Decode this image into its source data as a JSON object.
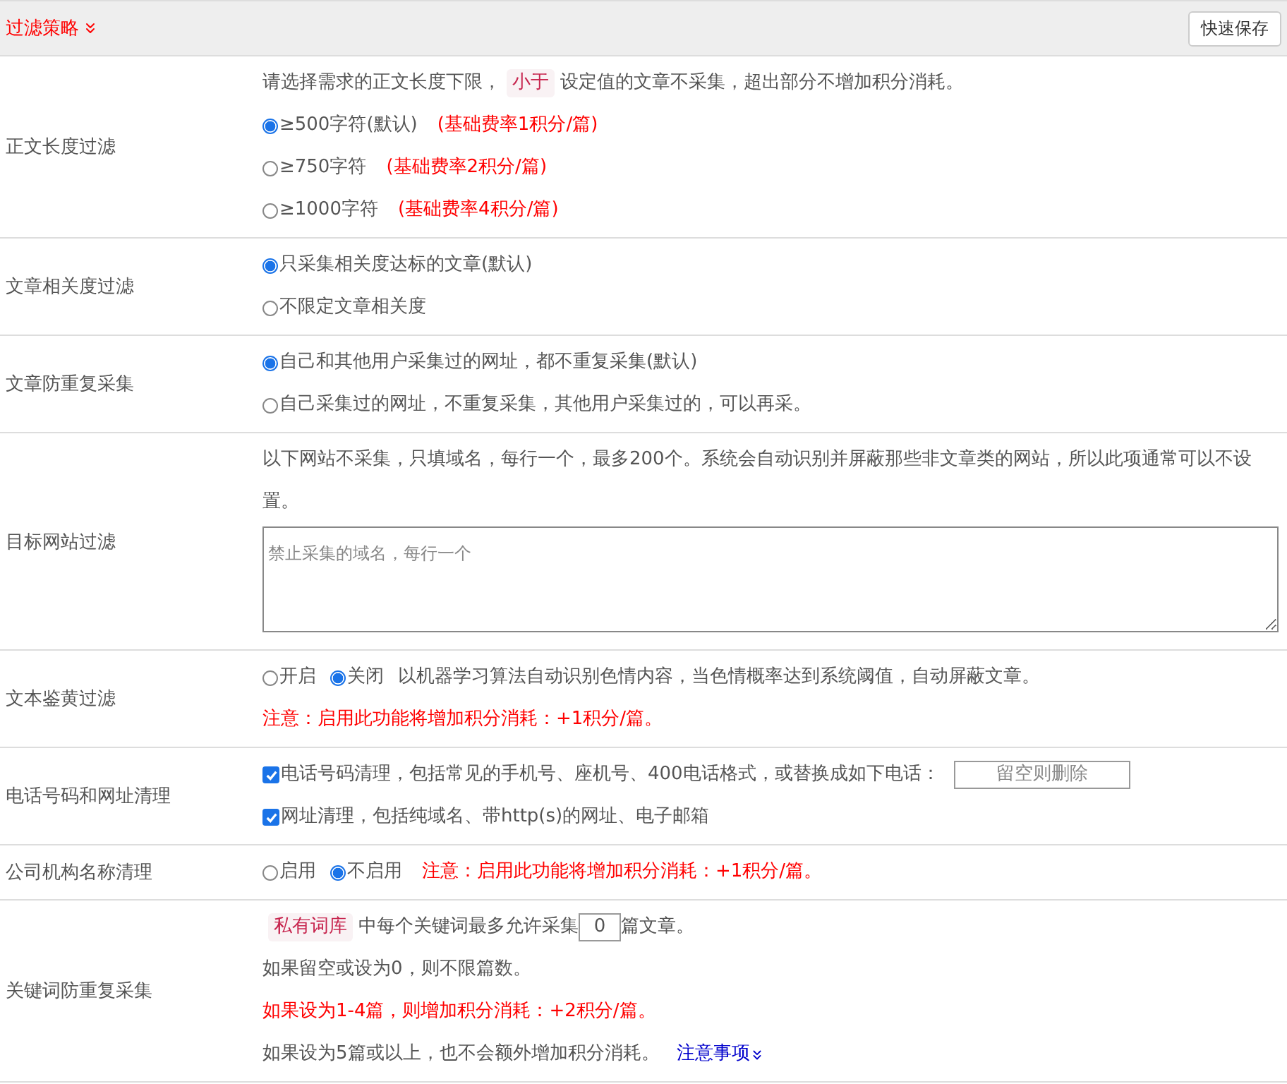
{
  "header": {
    "title": "过滤策略",
    "save_button": "快速保存"
  },
  "rows": [
    {
      "label": "正文长度过滤",
      "lines": [
        {
          "segments": [
            {
              "kind": "text",
              "text": "请选择需求的正文长度下限，"
            },
            {
              "kind": "badge",
              "text": "小于"
            },
            {
              "kind": "text",
              "text": "设定值的文章不采集，超出部分不增加积分消耗。"
            }
          ]
        },
        {
          "segments": [
            {
              "kind": "radio",
              "label": "≥500字符(默认)",
              "selected": true
            },
            {
              "kind": "note",
              "text": "(基础费率1积分/篇)"
            }
          ]
        },
        {
          "segments": [
            {
              "kind": "radio",
              "label": "≥750字符",
              "selected": false
            },
            {
              "kind": "note",
              "text": "(基础费率2积分/篇)"
            }
          ]
        },
        {
          "segments": [
            {
              "kind": "radio",
              "label": "≥1000字符",
              "selected": false
            },
            {
              "kind": "note",
              "text": "(基础费率4积分/篇)"
            }
          ]
        }
      ]
    },
    {
      "label": "文章相关度过滤",
      "lines": [
        {
          "segments": [
            {
              "kind": "radio",
              "label": "只采集相关度达标的文章(默认)",
              "selected": true
            }
          ]
        },
        {
          "segments": [
            {
              "kind": "radio",
              "label": "不限定文章相关度",
              "selected": false
            }
          ]
        }
      ]
    },
    {
      "label": "文章防重复采集",
      "lines": [
        {
          "segments": [
            {
              "kind": "radio",
              "label": "自己和其他用户采集过的网址，都不重复采集(默认)",
              "selected": true
            }
          ]
        },
        {
          "segments": [
            {
              "kind": "radio",
              "label": "自己采集过的网址，不重复采集，其他用户采集过的，可以再采。",
              "selected": false
            }
          ]
        }
      ]
    },
    {
      "label": "目标网站过滤",
      "lines": [
        {
          "segments": [
            {
              "kind": "text",
              "text": "以下网站不采集，只填域名，每行一个，最多200个。系统会自动识别并屏蔽那些非文章类的网站，所以此项通常可以不设置。"
            }
          ]
        },
        {
          "segments": [
            {
              "kind": "textarea",
              "placeholder": "禁止采集的域名，每行一个"
            }
          ]
        }
      ]
    },
    {
      "label": "文本鉴黄过滤",
      "lines": [
        {
          "segments": [
            {
              "kind": "radio",
              "label": "开启",
              "selected": false
            },
            {
              "kind": "radio",
              "label": "关闭",
              "selected": true
            },
            {
              "kind": "text",
              "text": "以机器学习算法自动识别色情内容，当色情概率达到系统阈值，自动屏蔽文章。"
            }
          ]
        },
        {
          "segments": [
            {
              "kind": "note",
              "text": "注意：启用此功能将增加积分消耗：+1积分/篇。"
            }
          ]
        }
      ]
    },
    {
      "label": "电话号码和网址清理",
      "lines": [
        {
          "segments": [
            {
              "kind": "checkbox",
              "label": "电话号码清理，包括常见的手机号、座机号、400电话格式，或替换成如下电话：",
              "checked": true
            },
            {
              "kind": "input",
              "placeholder": "留空则删除"
            }
          ]
        },
        {
          "segments": [
            {
              "kind": "checkbox",
              "label": "网址清理，包括纯域名、带http(s)的网址、电子邮箱",
              "checked": true
            }
          ]
        }
      ]
    },
    {
      "label": "公司机构名称清理",
      "lines": [
        {
          "segments": [
            {
              "kind": "radio",
              "label": "启用",
              "selected": false
            },
            {
              "kind": "radio",
              "label": "不启用",
              "selected": true
            },
            {
              "kind": "note",
              "text": "注意：启用此功能将增加积分消耗：+1积分/篇。"
            }
          ]
        }
      ]
    },
    {
      "label": "关键词防重复采集",
      "lines": [
        {
          "segments": [
            {
              "kind": "badge",
              "text": "私有词库"
            },
            {
              "kind": "text",
              "text": "中每个关键词最多允许采集"
            },
            {
              "kind": "input",
              "value": "0"
            },
            {
              "kind": "text",
              "text": "篇文章。"
            }
          ]
        },
        {
          "segments": [
            {
              "kind": "text",
              "text": "如果留空或设为0，则不限篇数。"
            }
          ]
        },
        {
          "segments": [
            {
              "kind": "note",
              "text": "如果设为1-4篇，则增加积分消耗：+2积分/篇。"
            }
          ]
        },
        {
          "segments": [
            {
              "kind": "text",
              "text": "如果设为5篇或以上，也不会额外增加积分消耗。"
            },
            {
              "kind": "link",
              "text": "注意事项"
            }
          ]
        }
      ]
    }
  ]
}
